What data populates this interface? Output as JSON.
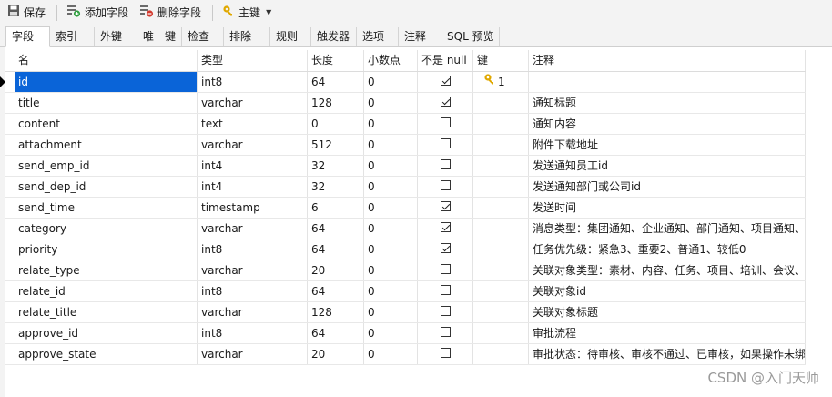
{
  "toolbar": {
    "save": "保存",
    "add_field": "添加字段",
    "delete_field": "删除字段",
    "primary_key": "主键"
  },
  "tabs": [
    "字段",
    "索引",
    "外键",
    "唯一键",
    "检查",
    "排除",
    "规则",
    "触发器",
    "选项",
    "注释",
    "SQL 预览"
  ],
  "active_tab": "字段",
  "columns": [
    "名",
    "类型",
    "长度",
    "小数点",
    "不是 null",
    "键",
    "注释"
  ],
  "rows": [
    {
      "name": "id",
      "type": "int8",
      "length": "64",
      "decimal": "0",
      "not_null": true,
      "key": "1",
      "comment": ""
    },
    {
      "name": "title",
      "type": "varchar",
      "length": "128",
      "decimal": "0",
      "not_null": true,
      "key": "",
      "comment": "通知标题"
    },
    {
      "name": "content",
      "type": "text",
      "length": "0",
      "decimal": "0",
      "not_null": false,
      "key": "",
      "comment": "通知内容"
    },
    {
      "name": "attachment",
      "type": "varchar",
      "length": "512",
      "decimal": "0",
      "not_null": false,
      "key": "",
      "comment": "附件下载地址"
    },
    {
      "name": "send_emp_id",
      "type": "int4",
      "length": "32",
      "decimal": "0",
      "not_null": false,
      "key": "",
      "comment": "发送通知员工id"
    },
    {
      "name": "send_dep_id",
      "type": "int4",
      "length": "32",
      "decimal": "0",
      "not_null": false,
      "key": "",
      "comment": "发送通知部门或公司id"
    },
    {
      "name": "send_time",
      "type": "timestamp",
      "length": "6",
      "decimal": "0",
      "not_null": true,
      "key": "",
      "comment": "发送时间"
    },
    {
      "name": "category",
      "type": "varchar",
      "length": "64",
      "decimal": "0",
      "not_null": true,
      "key": "",
      "comment": "消息类型：集团通知、企业通知、部门通知、项目通知、"
    },
    {
      "name": "priority",
      "type": "int8",
      "length": "64",
      "decimal": "0",
      "not_null": true,
      "key": "",
      "comment": "任务优先级：紧急3、重要2、普通1、较低0"
    },
    {
      "name": "relate_type",
      "type": "varchar",
      "length": "20",
      "decimal": "0",
      "not_null": false,
      "key": "",
      "comment": "关联对象类型：素材、内容、任务、项目、培训、会议、"
    },
    {
      "name": "relate_id",
      "type": "int8",
      "length": "64",
      "decimal": "0",
      "not_null": false,
      "key": "",
      "comment": "关联对象id"
    },
    {
      "name": "relate_title",
      "type": "varchar",
      "length": "128",
      "decimal": "0",
      "not_null": false,
      "key": "",
      "comment": "关联对象标题"
    },
    {
      "name": "approve_id",
      "type": "int8",
      "length": "64",
      "decimal": "0",
      "not_null": false,
      "key": "",
      "comment": "审批流程"
    },
    {
      "name": "approve_state",
      "type": "varchar",
      "length": "20",
      "decimal": "0",
      "not_null": false,
      "key": "",
      "comment": "审批状态：待审核、审核不通过、已审核，如果操作未绑"
    }
  ],
  "selected_row": 0,
  "watermark": "CSDN @入门天师"
}
